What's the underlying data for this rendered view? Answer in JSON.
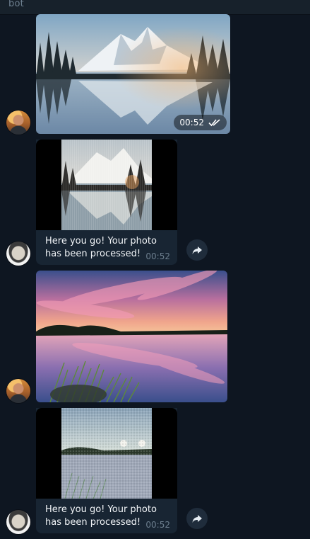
{
  "header": {
    "title": "bot"
  },
  "messages": [
    {
      "kind": "user_photo",
      "time": "00:52",
      "status": "read-double-check"
    },
    {
      "kind": "bot_result",
      "caption": "Here you go! Your photo has been processed!",
      "time": "00:52"
    },
    {
      "kind": "user_photo",
      "time": ""
    },
    {
      "kind": "bot_result",
      "caption": "Here you go! Your photo has been processed!",
      "time": "00:52"
    }
  ],
  "icons": {
    "share": "share-arrow-icon",
    "check": "double-check-icon"
  },
  "colors": {
    "background": "#0e1621",
    "bubble": "#182533",
    "header": "#17212b",
    "muted_text": "#6d7f8f"
  }
}
